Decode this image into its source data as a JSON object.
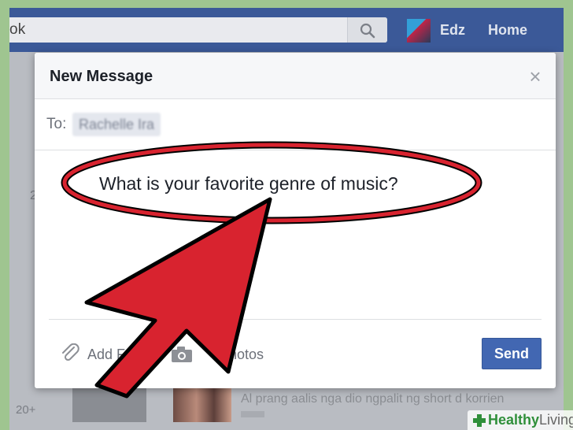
{
  "topbar": {
    "search_text": "ok",
    "user_name": "Edz",
    "home_label": "Home"
  },
  "background": {
    "feed_text": "Al prang aalis nga dio ngpalit ng short d korrien",
    "side_number": "2",
    "side_badge": "20+"
  },
  "dialog": {
    "title": "New Message",
    "close_glyph": "×",
    "to_label": "To:",
    "recipient": "Rachelle Ira",
    "message": "What is your favorite genre of music?",
    "add_files_label": "Add F",
    "add_photos_label": "Photos",
    "send_label": "Send"
  },
  "annotation": {
    "ellipse_color": "#d8232f",
    "arrow_color": "#d8232f",
    "outline_color": "#000000"
  },
  "watermark": {
    "brand_a": "Healthy",
    "brand_b": "Living"
  }
}
